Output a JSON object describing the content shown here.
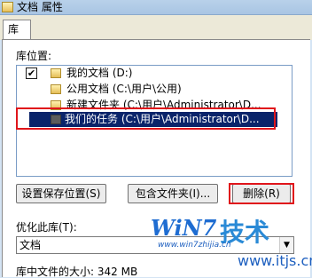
{
  "window": {
    "title": "文档 属性"
  },
  "tabs": [
    {
      "label": "库"
    }
  ],
  "library_locations": {
    "label": "库位置:",
    "items": [
      {
        "checked": true,
        "label": "我的文档 (D:)"
      },
      {
        "checked": false,
        "label": "公用文档 (C:\\用户\\公用)"
      },
      {
        "checked": false,
        "label": "新建文件夹 (C:\\用户\\Administrator\\D..."
      },
      {
        "checked": false,
        "label": "我们的任务 (C:\\用户\\Administrator\\D...",
        "selected": true
      }
    ]
  },
  "buttons": {
    "set_save": "设置保存位置(S)",
    "include_folder": "包含文件夹(I)...",
    "delete": "删除(R)"
  },
  "optimize": {
    "label": "优化此库(T):",
    "value": "文档"
  },
  "size_info": {
    "label": "库中文件的大小:",
    "value": "342 MB"
  },
  "watermark": {
    "logo": "WiN7",
    "big": "技术",
    "url": "www.win7zhijia.cn",
    "url2": "www.itjs.cn"
  },
  "colors": {
    "selection": "#0a246a",
    "highlight": "#e0151b"
  }
}
